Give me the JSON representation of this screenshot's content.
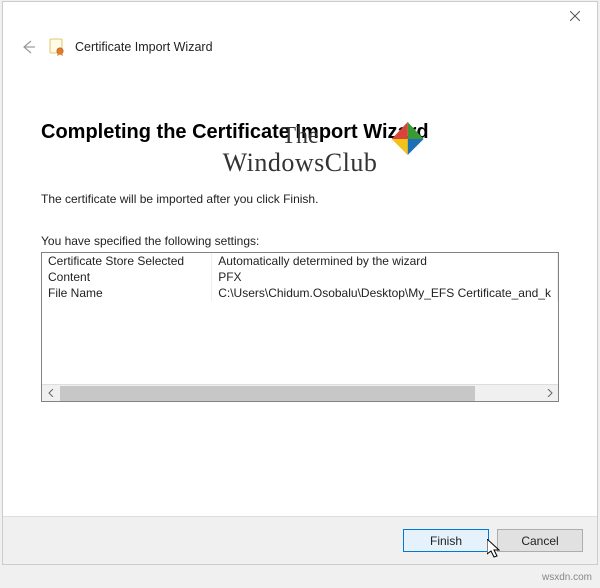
{
  "header": {
    "wizard_title": "Certificate Import Wizard"
  },
  "watermark": {
    "line1": "The",
    "line2": "WindowsClub"
  },
  "main": {
    "heading": "Completing the Certificate Import Wizard",
    "body": "The certificate will be imported after you click Finish.",
    "settings_label": "You have specified the following settings:",
    "rows": [
      {
        "label": "Certificate Store Selected",
        "value": "Automatically determined by the wizard"
      },
      {
        "label": "Content",
        "value": "PFX"
      },
      {
        "label": "File Name",
        "value": "C:\\Users\\Chidum.Osobalu\\Desktop\\My_EFS Certificate_and_k"
      }
    ]
  },
  "footer": {
    "finish": "Finish",
    "cancel": "Cancel"
  },
  "credit": "wsxdn.com"
}
